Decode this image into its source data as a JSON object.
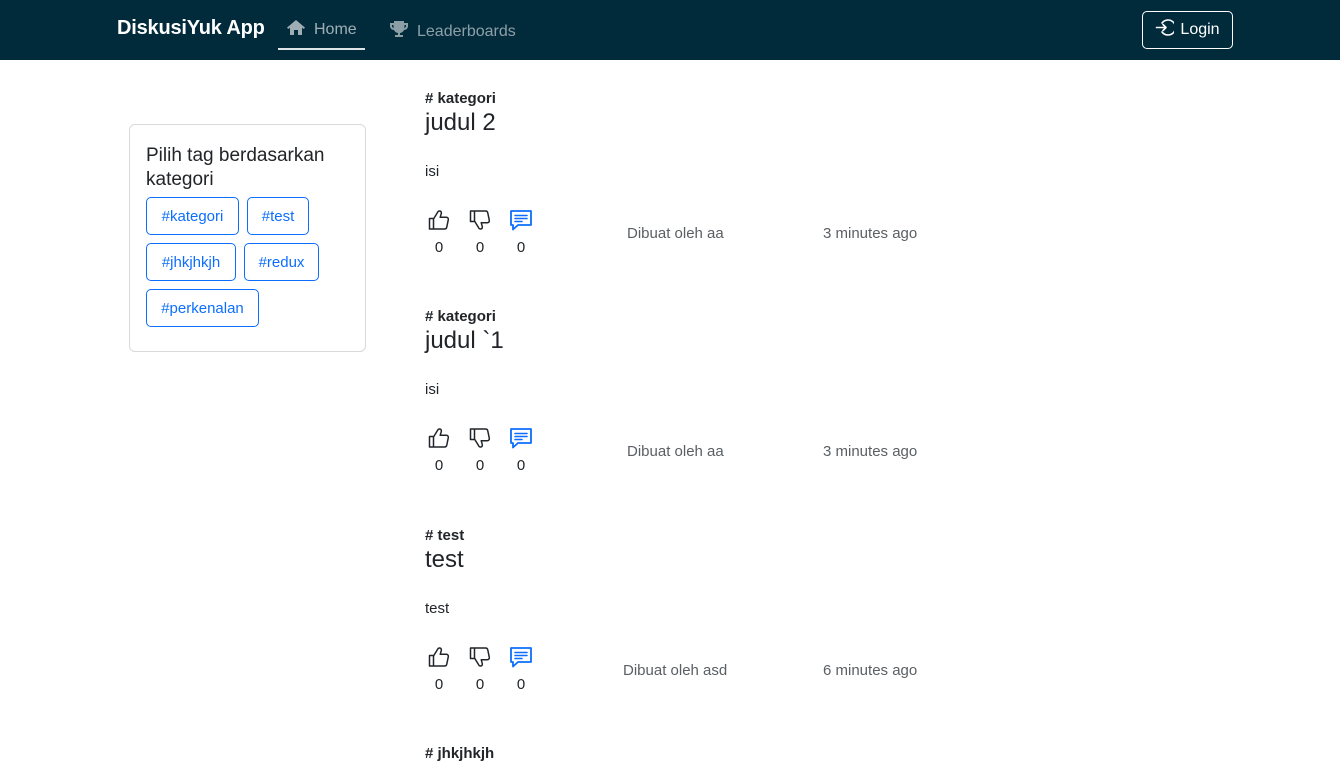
{
  "navbar": {
    "brand": "DiskusiYuk App",
    "home_label": "Home",
    "leaderboards_label": "Leaderboards",
    "login_label": "Login"
  },
  "sidebar": {
    "title": "Pilih tag berdasarkan kategori",
    "tags": [
      "#kategori",
      "#test",
      "#jhkjhkjh",
      "#redux",
      "#perkenalan"
    ]
  },
  "threads": [
    {
      "category": "# kategori",
      "title": "judul 2",
      "body": "isi",
      "likes": "0",
      "dislikes": "0",
      "comments": "0",
      "author": "Dibuat oleh aa",
      "time": "3 minutes ago"
    },
    {
      "category": "# kategori",
      "title": "judul `1",
      "body": "isi",
      "likes": "0",
      "dislikes": "0",
      "comments": "0",
      "author": "Dibuat oleh aa",
      "time": "3 minutes ago"
    },
    {
      "category": "# test",
      "title": "test",
      "body": "test",
      "likes": "0",
      "dislikes": "0",
      "comments": "0",
      "author": "Dibuat oleh asd",
      "time": "6 minutes ago"
    },
    {
      "category": "# jhkjhkjh"
    }
  ],
  "icons": {
    "home": "home-icon",
    "leaderboards": "trophy-icon",
    "login": "login-icon",
    "like": "thumbs-up-icon",
    "dislike": "thumbs-down-icon",
    "comment": "comment-icon"
  },
  "colors": {
    "navbar_bg": "#012a3b",
    "accent": "#0d6efd"
  }
}
